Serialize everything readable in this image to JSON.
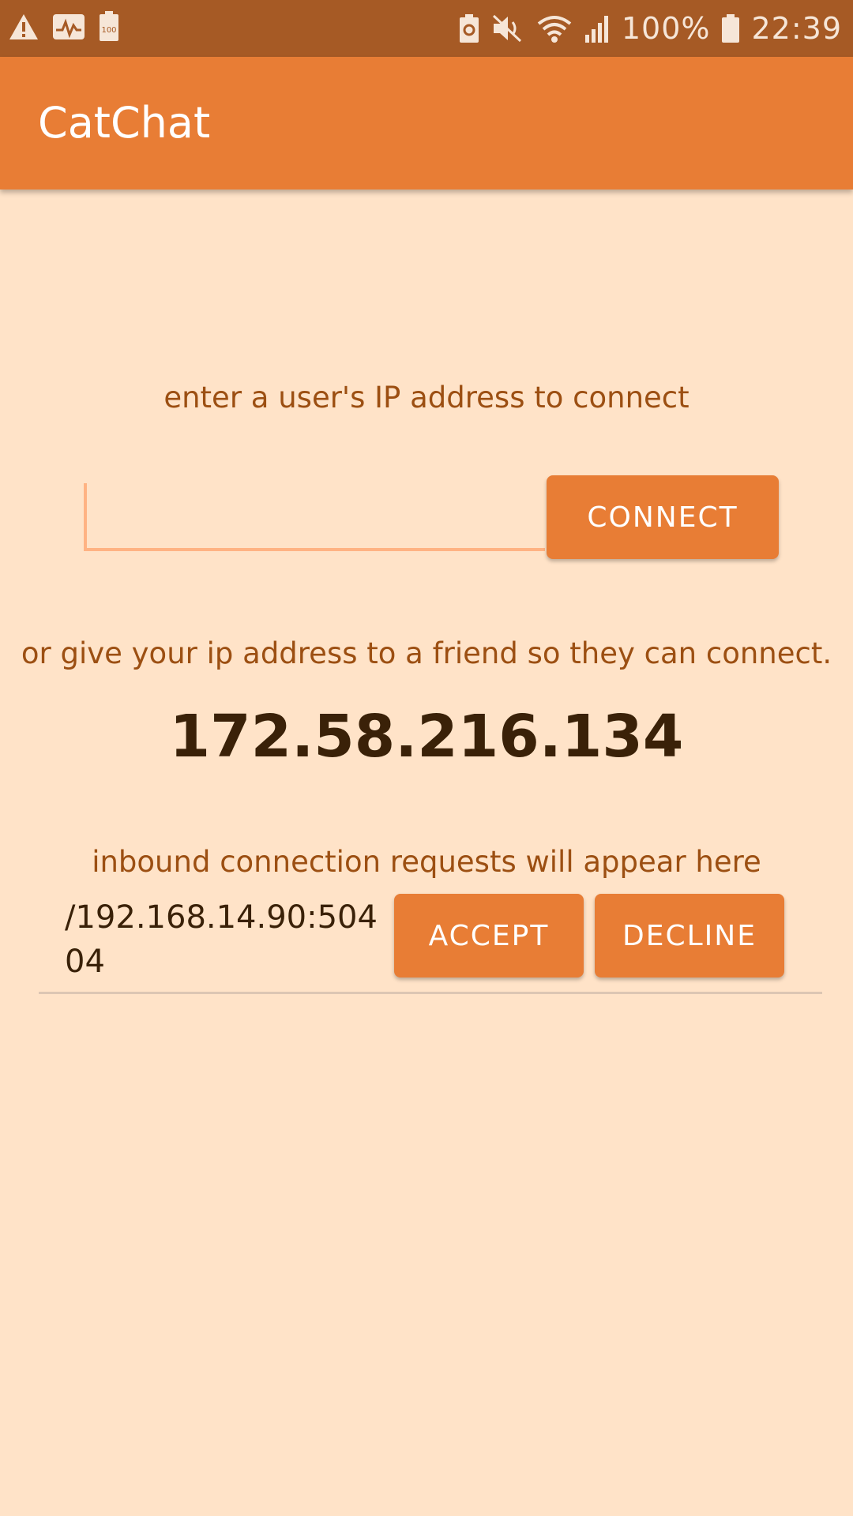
{
  "status_bar": {
    "left_icons": [
      "warning-icon",
      "activity-icon",
      "battery-saver-icon"
    ],
    "right_icons": [
      "battery-recycle-icon",
      "vibrate-mute-icon",
      "wifi-icon",
      "signal-icon"
    ],
    "battery_percent": "100%",
    "time": "22:39"
  },
  "app_bar": {
    "title": "CatChat"
  },
  "connect": {
    "prompt": "enter a user's IP address to connect",
    "ip_value": "",
    "button_label": "CONNECT"
  },
  "share": {
    "prompt": "or give your ip address to a friend so they can connect.",
    "my_ip": "172.58.216.134"
  },
  "requests": {
    "prompt": "inbound connection requests will appear here",
    "items": [
      {
        "address": "/192.168.14.90:50404",
        "accept_label": "ACCEPT",
        "decline_label": "DECLINE"
      }
    ]
  },
  "colors": {
    "status_bar": "#A65A25",
    "app_bar": "#E87D35",
    "background": "#FFE3C8",
    "label_text": "#9C4F12",
    "accent_line": "#FFB383"
  }
}
